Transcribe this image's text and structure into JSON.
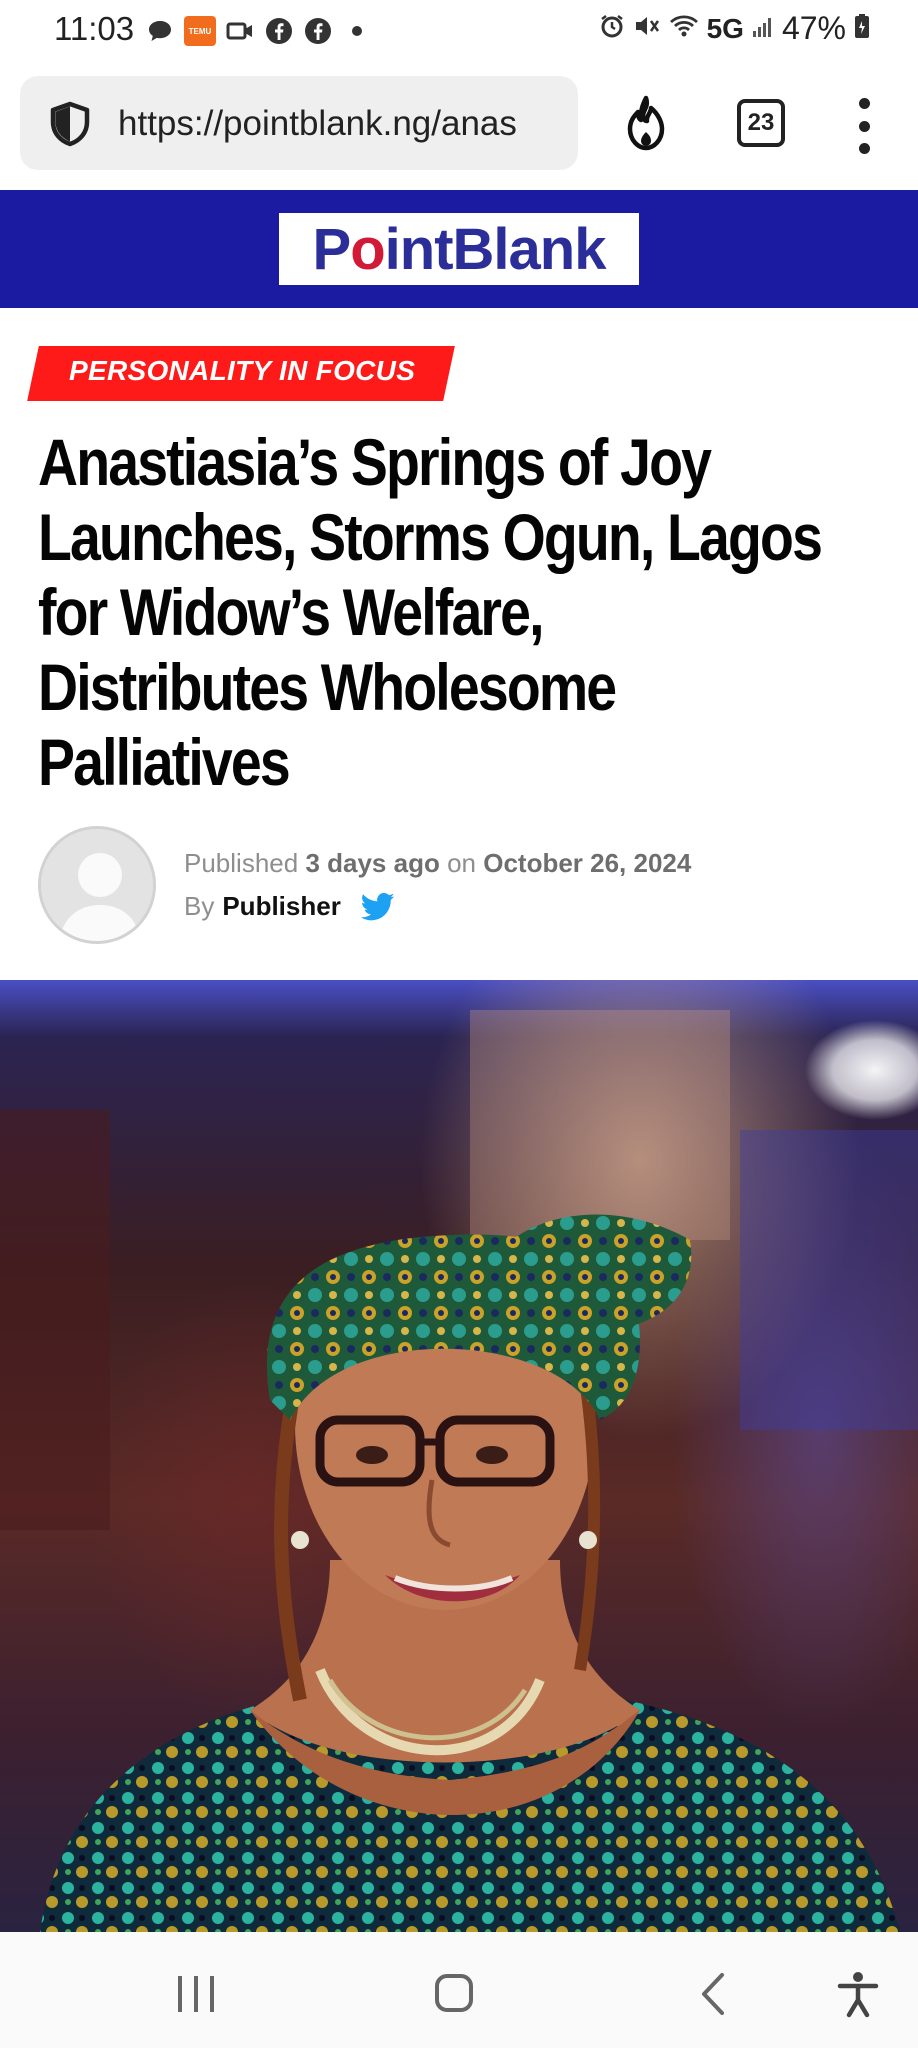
{
  "status_bar": {
    "time": "11:03",
    "left_icons": [
      "chat-bubble-icon",
      "temu-app-icon",
      "video-icon",
      "facebook-icon",
      "facebook-icon",
      "dot-icon"
    ],
    "temu_label": "TEMU",
    "network": "5G",
    "battery": "47%",
    "right_icons": [
      "alarm-icon",
      "mute-icon",
      "wifi-icon",
      "signal-icon",
      "battery-icon"
    ]
  },
  "browser": {
    "url": "https://pointblank.ng/anas",
    "tab_count": "23"
  },
  "site": {
    "logo_text_p": "P",
    "logo_text_o": "o",
    "logo_text_rest": "intBlank",
    "header_color": "#1a1ba1"
  },
  "article": {
    "category": "PERSONALITY IN FOCUS",
    "headline_lines": [
      "Anastiasia’s Springs of Joy",
      "Launches, Storms Ogun, Lagos",
      "for Widow’s Welfare,",
      "Distributes Wholesome",
      "Palliatives"
    ],
    "published_prefix": "Published",
    "published_relative": "3 days ago",
    "published_on": "on",
    "published_date": "October 26, 2024",
    "by_label": "By",
    "author": "Publisher"
  },
  "nav": {
    "items": [
      "recents-icon",
      "home-icon",
      "back-icon",
      "accessibility-icon"
    ]
  },
  "colors": {
    "badge": "#ff1a1a",
    "twitter": "#1da1f2"
  }
}
